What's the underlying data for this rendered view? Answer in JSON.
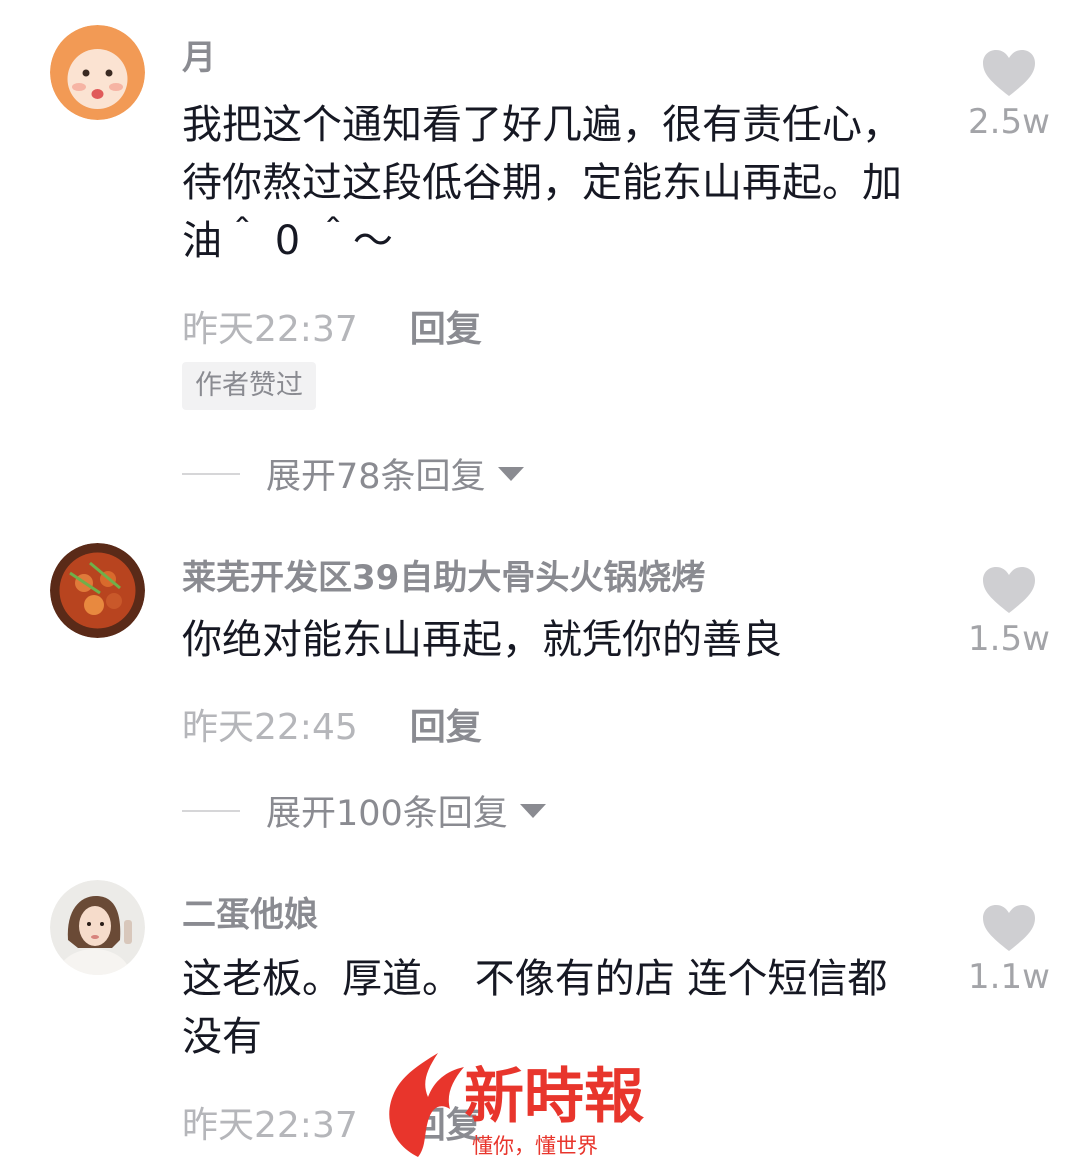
{
  "comments": [
    {
      "username": "月",
      "text": "我把这个通知看了好几遍，很有责任心，待你熬过这段低谷期，定能东山再起。加油＾ 0 ＾～",
      "time": "昨天22:37",
      "reply_label": "回复",
      "badge": "作者赞过",
      "expand_label": "展开78条回复",
      "likes": "2.5w"
    },
    {
      "username": "莱芜开发区39自助大骨头火锅烧烤",
      "text": "你绝对能东山再起，就凭你的善良",
      "time": "昨天22:45",
      "reply_label": "回复",
      "expand_label": "展开100条回复",
      "likes": "1.5w"
    },
    {
      "username": "二蛋他娘",
      "text": "这老板。厚道。 不像有的店 连个短信都没有",
      "time": "昨天22:37",
      "reply_label": "回复",
      "likes": "1.1w"
    }
  ],
  "watermark": {
    "brand": "新時報",
    "slogan": "懂你，懂世界"
  },
  "colors": {
    "username": "#8a8b91",
    "body_text": "#161823",
    "timestamp": "#b5b6ba",
    "heart": "#cfcfd2",
    "watermark_red": "#e8352c"
  }
}
